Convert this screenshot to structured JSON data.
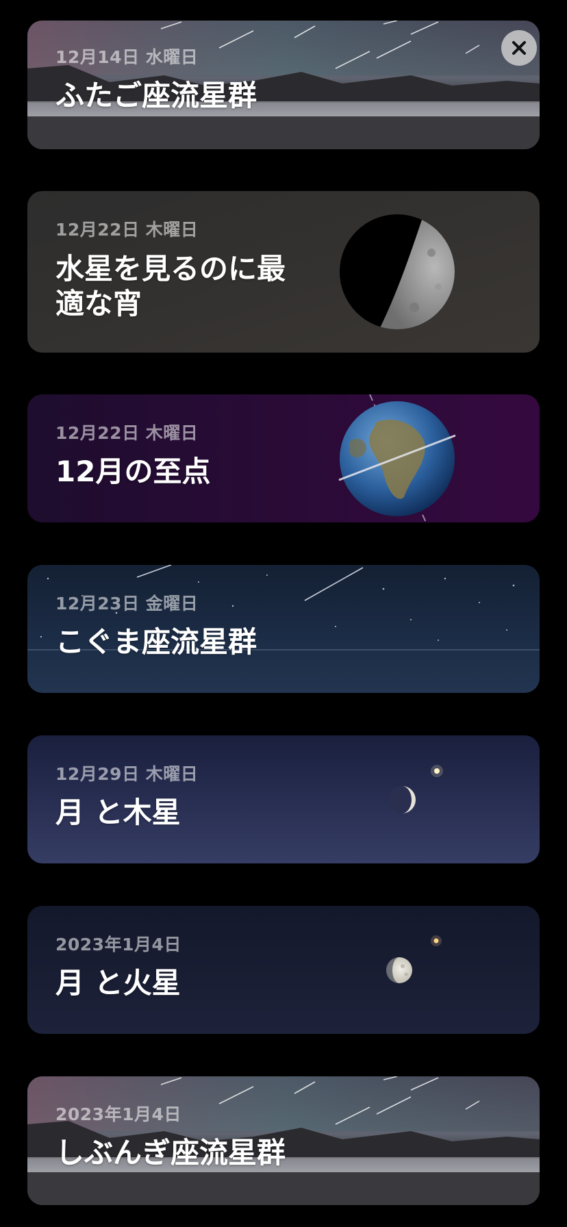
{
  "events": [
    {
      "date": "12月14日 水曜日",
      "title": "ふたご座流星群",
      "icon": "meteor-shower-lake-image"
    },
    {
      "date": "12月22日 木曜日",
      "title": "水星を見るのに最\n適な宵",
      "icon": "mercury-phase-image"
    },
    {
      "date": "12月22日 木曜日",
      "title": "12月の至点",
      "icon": "earth-solstice-image"
    },
    {
      "date": "12月23日 金曜日",
      "title": "こぐま座流星群",
      "icon": "meteor-shower-sea-image"
    },
    {
      "date": "12月29日 木曜日",
      "title": "月 と木星",
      "icon": "moon-jupiter-image"
    },
    {
      "date": "2023年1月4日",
      "title": "月 と火星",
      "icon": "moon-mars-image"
    },
    {
      "date": "2023年1月4日",
      "title": "しぶんぎ座流星群",
      "icon": "meteor-shower-lake-image"
    }
  ],
  "close_icon": "close-icon",
  "colors": {
    "background": "#000000",
    "solstice_card": "#2a0b3d",
    "moon_card": "#1e2545",
    "mars_card": "#161a30"
  }
}
